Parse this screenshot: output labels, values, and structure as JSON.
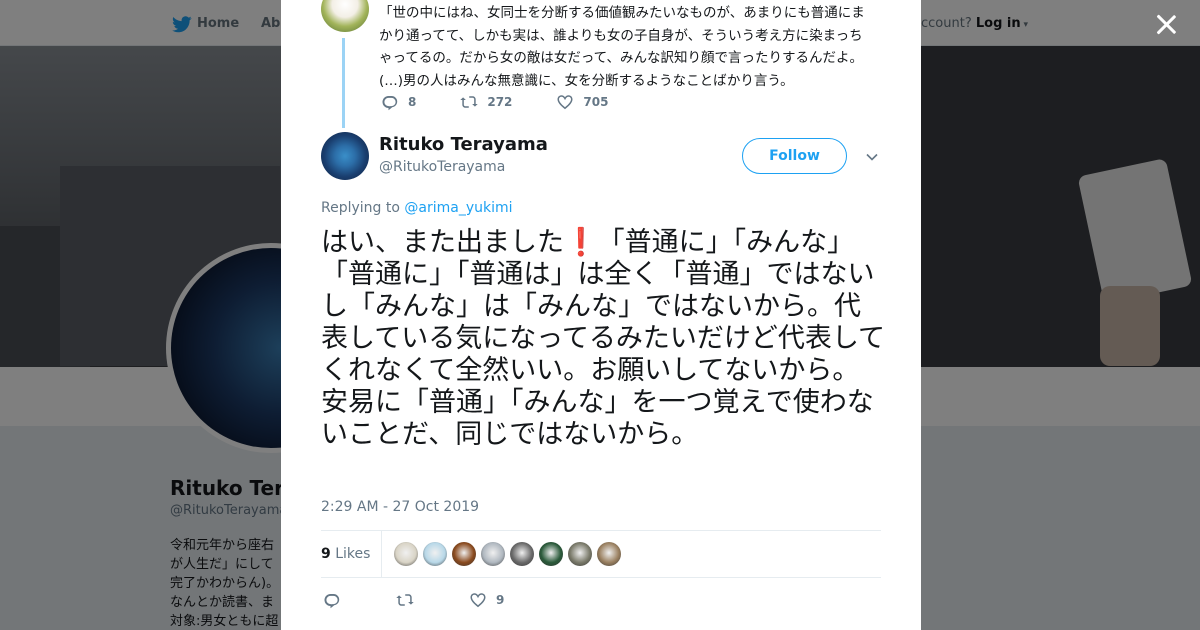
{
  "background_page": {
    "nav": {
      "home_label": "Home",
      "about_label": "Abo",
      "account_prompt": "ccount?",
      "login_label": "Log in"
    },
    "profile": {
      "name": "Rituko Terayama",
      "handle": "@RitukoTerayama",
      "bio": "令和元年から座右\nが人生だ」にして\n完了かわからん)。\nなんとか読書、ま\n対象:男女ともに超"
    }
  },
  "modal": {
    "close_label": "close",
    "parent_tweet": {
      "text": "「世の中にはね、女同士を分断する価値観みたいなものが、あまりにも普通にまかり通ってて、しかも実は、誰よりも女の子自身が、そういう考え方に染まっちゃってるの。だから女の敵は女だって、みんな訳知り顔で言ったりするんだよ。(…)男の人はみんな無意識に、女を分断するようなことばかり言う。",
      "reply_count": "8",
      "retweet_count": "272",
      "like_count": "705"
    },
    "tweet": {
      "author_name": "Rituko Terayama",
      "author_handle": "@RitukoTerayama",
      "follow_label": "Follow",
      "replying_prefix": "Replying to",
      "replying_to": "@arima_yukimi",
      "text_part1": "はい、また出ました",
      "emoji": "❗",
      "text_part2": "「普通に」「みんな」「普通に」「普通は」は全く「普通」ではないし「みんな」は「みんな」ではないから。代表している気になってるみたいだけど代表してくれなくて全然いい。お願いしてないから。安易に「普通」「みんな」を一つ覚えで使わないことだ、同じではないから。",
      "timestamp": "2:29 AM - 27 Oct 2019",
      "likes_count": "9",
      "likes_label": "Likes",
      "liker_colors": [
        "#d9d4c6",
        "#b8d8e8",
        "#8a4a1e",
        "#b0b8c0",
        "#6a6a6a",
        "#2a5a3a",
        "#7a7a6a",
        "#9a8060"
      ],
      "bottom_like_count": "9"
    }
  }
}
